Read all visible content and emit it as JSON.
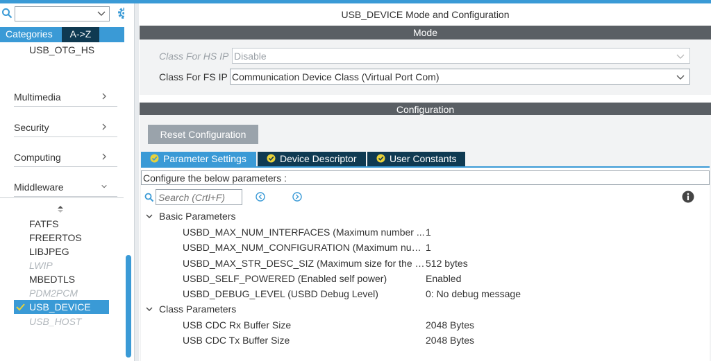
{
  "sidebar": {
    "search_value": "",
    "tabs": {
      "categories": "Categories",
      "az": "A->Z"
    },
    "top_item": "USB_OTG_HS",
    "groups": [
      "Multimedia",
      "Security",
      "Computing",
      "Middleware"
    ],
    "middleware_items": [
      {
        "label": "FATFS",
        "state": "normal"
      },
      {
        "label": "FREERTOS",
        "state": "normal"
      },
      {
        "label": "LIBJPEG",
        "state": "normal"
      },
      {
        "label": "LWIP",
        "state": "disabled"
      },
      {
        "label": "MBEDTLS",
        "state": "normal"
      },
      {
        "label": "PDM2PCM",
        "state": "disabled"
      },
      {
        "label": "USB_DEVICE",
        "state": "selected"
      },
      {
        "label": "USB_HOST",
        "state": "disabled"
      }
    ]
  },
  "main": {
    "title": "USB_DEVICE Mode and Configuration",
    "mode_bar": "Mode",
    "mode": {
      "hs_label": "Class For HS IP",
      "hs_value": "Disable",
      "fs_label": "Class For FS IP",
      "fs_value": "Communication Device Class (Virtual Port Com)"
    },
    "config_bar": "Configuration",
    "reset_label": "Reset Configuration",
    "tabs": [
      "Parameter Settings",
      "Device Descriptor",
      "User Constants"
    ],
    "hint": "Configure the below parameters :",
    "search_placeholder": "Search (Crtl+F)",
    "groups": [
      {
        "label": "Basic Parameters",
        "rows": [
          {
            "name": "USBD_MAX_NUM_INTERFACES (Maximum number ...",
            "value": "1"
          },
          {
            "name": "USBD_MAX_NUM_CONFIGURATION (Maximum num...",
            "value": "1"
          },
          {
            "name": "USBD_MAX_STR_DESC_SIZ (Maximum size for the s...",
            "value": "512 bytes"
          },
          {
            "name": "USBD_SELF_POWERED (Enabled self power)",
            "value": "Enabled"
          },
          {
            "name": "USBD_DEBUG_LEVEL (USBD Debug Level)",
            "value": "0: No debug message"
          }
        ]
      },
      {
        "label": "Class Parameters",
        "rows": [
          {
            "name": "USB CDC Rx Buffer Size",
            "value": "2048 Bytes"
          },
          {
            "name": "USB CDC Tx Buffer Size",
            "value": "2048 Bytes"
          }
        ]
      }
    ]
  },
  "colors": {
    "accent": "#3a9ad6",
    "dark_tab": "#0f3a52",
    "bar": "#5a5f64"
  }
}
